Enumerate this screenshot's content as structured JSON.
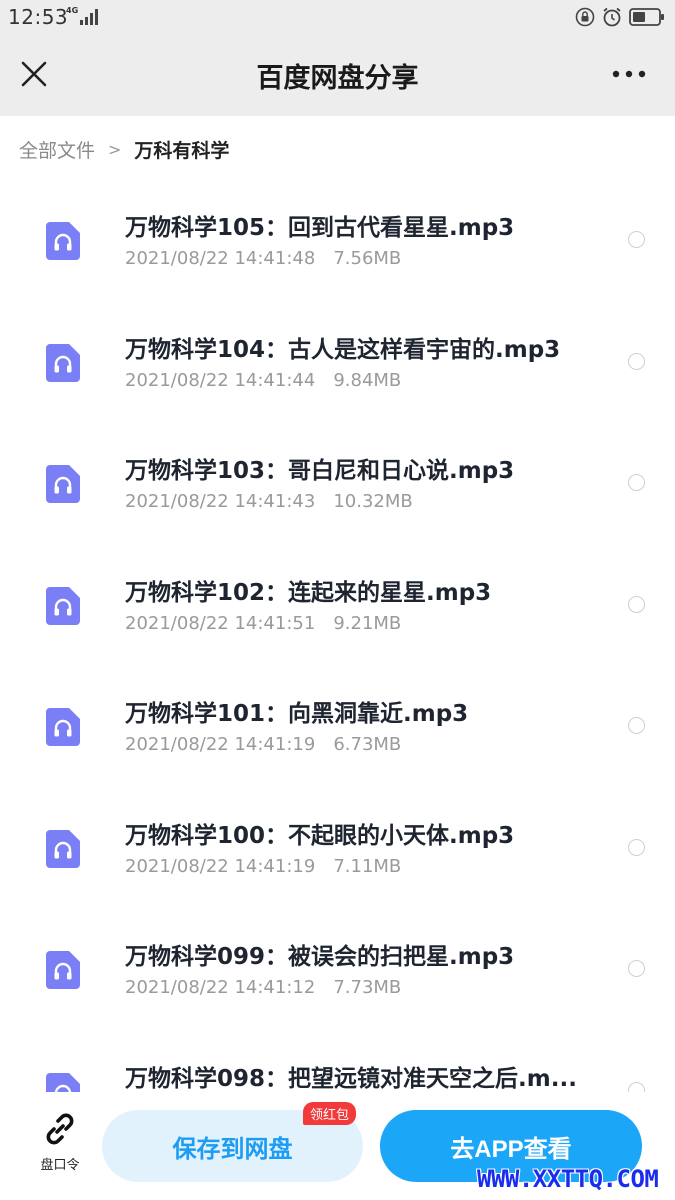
{
  "status_bar": {
    "time": "12:53",
    "network": "4G",
    "icons": [
      "signal-icon",
      "lock-rotation-icon",
      "alarm-icon",
      "battery-icon"
    ]
  },
  "header": {
    "title": "百度网盘分享",
    "icons": [
      "close-icon",
      "more-icon"
    ]
  },
  "breadcrumb": {
    "root": "全部文件",
    "separator": ">",
    "current": "万科有科学"
  },
  "files": [
    {
      "name": "万物科学105：回到古代看星星.mp3",
      "date": "2021/08/22 14:41:48",
      "size": "7.56MB"
    },
    {
      "name": "万物科学104：古人是这样看宇宙的.mp3",
      "date": "2021/08/22 14:41:44",
      "size": "9.84MB"
    },
    {
      "name": "万物科学103：哥白尼和日心说.mp3",
      "date": "2021/08/22 14:41:43",
      "size": "10.32MB"
    },
    {
      "name": "万物科学102：连起来的星星.mp3",
      "date": "2021/08/22 14:41:51",
      "size": "9.21MB"
    },
    {
      "name": "万物科学101：向黑洞靠近.mp3",
      "date": "2021/08/22 14:41:19",
      "size": "6.73MB"
    },
    {
      "name": "万物科学100：不起眼的小天体.mp3",
      "date": "2021/08/22 14:41:19",
      "size": "7.11MB"
    },
    {
      "name": "万物科学099：被误会的扫把星.mp3",
      "date": "2021/08/22 14:41:12",
      "size": "7.73MB"
    },
    {
      "name": "万物科学098：把望远镜对准天空之后.m...",
      "date": "",
      "size": ""
    }
  ],
  "bottom_bar": {
    "pan_ling_label": "盘口令",
    "save_label": "保存到网盘",
    "badge": "领红包",
    "app_label": "去APP查看"
  },
  "watermark": "WWW.XXTTQ.COM",
  "colors": {
    "accent": "#1ca6f7",
    "file_icon": "#7b7ff5",
    "badge": "#f23a3a",
    "header_bg": "#ededed",
    "watermark": "#1a2cf0"
  }
}
